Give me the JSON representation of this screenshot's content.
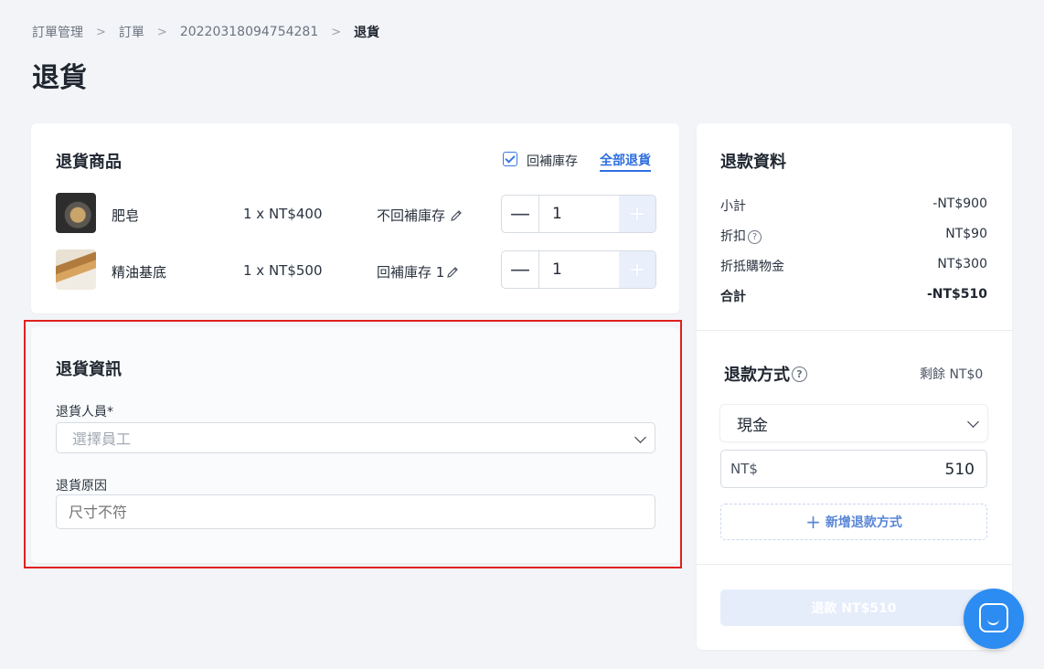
{
  "breadcrumb": {
    "items": [
      "訂單管理",
      "訂單",
      "20220318094754281"
    ],
    "current": "退貨"
  },
  "page_title": "退貨",
  "products": {
    "title": "退貨商品",
    "restock_checkbox_label": "回補庫存",
    "restock_checked": true,
    "return_all_label": "全部退貨",
    "items": [
      {
        "name": "肥皂",
        "price": "1 x NT$400",
        "restock": "不回補庫存",
        "qty": "1"
      },
      {
        "name": "精油基底",
        "price": "1 x NT$500",
        "restock": "回補庫存 1",
        "qty": "1"
      }
    ]
  },
  "return_info": {
    "title": "退貨資訊",
    "staff_label": "退貨人員*",
    "staff_placeholder": "選擇員工",
    "reason_label": "退貨原因",
    "reason_placeholder": "尺寸不符"
  },
  "refund": {
    "title": "退款資料",
    "rows": [
      {
        "label": "小計",
        "value": "-NT$900"
      },
      {
        "label": "折扣",
        "value": "NT$90"
      },
      {
        "label": "折抵購物金",
        "value": "NT$300"
      },
      {
        "label": "合計",
        "value": "-NT$510"
      }
    ],
    "method_title": "退款方式",
    "remaining": "剩餘 NT$0",
    "method_selected": "現金",
    "currency": "NT$",
    "amount": "510",
    "add_method": "新增退款方式",
    "submit": "退款 NT$510"
  },
  "colors": {
    "accent": "#2f6fe0",
    "highlight_border": "#e02020",
    "chat": "#2c8cf2"
  }
}
